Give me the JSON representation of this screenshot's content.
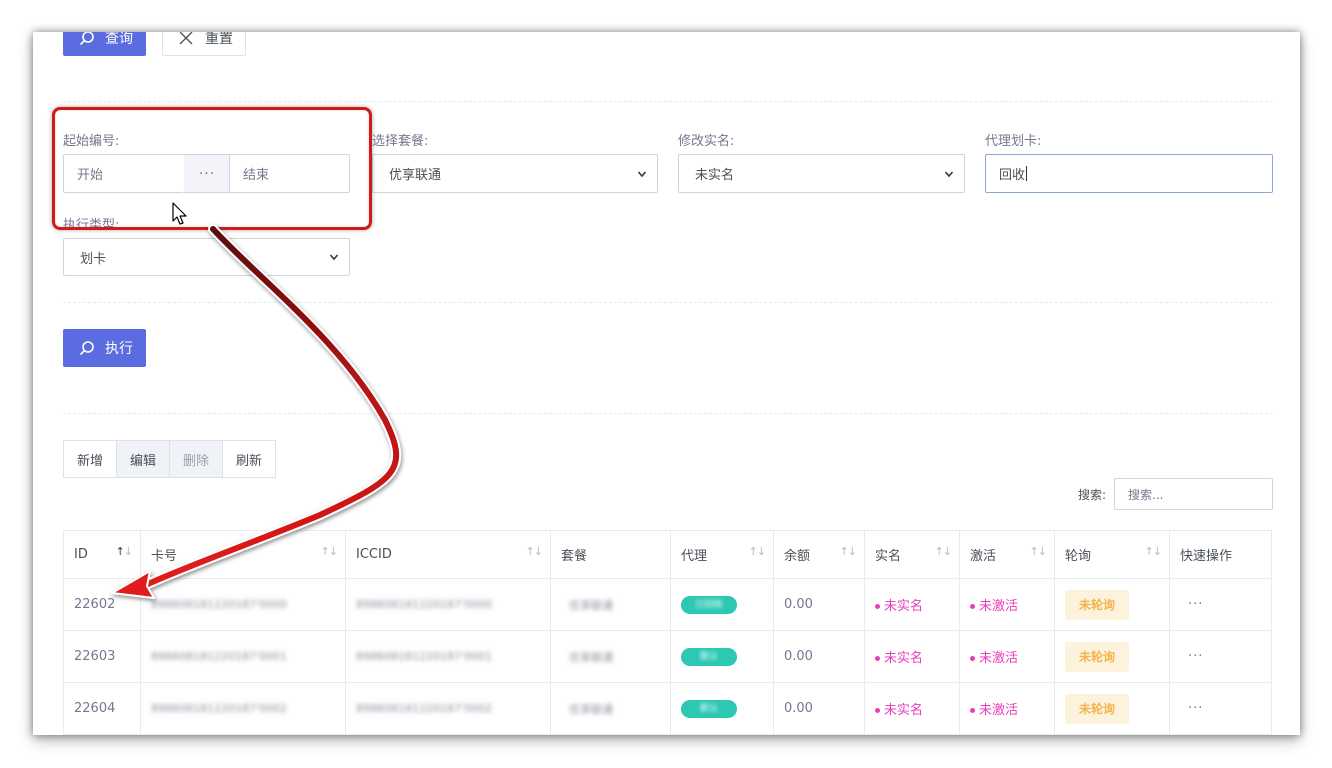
{
  "toolbar": {
    "query_label": "查询",
    "reset_label": "重置"
  },
  "filters": {
    "start_number": {
      "label": "起始编号:",
      "start_placeholder": "开始",
      "separator": "···",
      "end_placeholder": "结束"
    },
    "package": {
      "label": "选择套餐:",
      "value": "优享联通"
    },
    "realname": {
      "label": "修改实名:",
      "value": "未实名"
    },
    "agent": {
      "label": "代理划卡:",
      "value": "回收"
    },
    "exec_type": {
      "label": "执行类型:",
      "value": "划卡"
    }
  },
  "execute_label": "执行",
  "actions": {
    "add": "新增",
    "edit": "编辑",
    "delete": "删除",
    "refresh": "刷新"
  },
  "search": {
    "label": "搜索:",
    "placeholder": "搜索..."
  },
  "table": {
    "columns": [
      "ID",
      "卡号",
      "ICCID",
      "套餐",
      "代理",
      "余额",
      "实名",
      "激活",
      "轮询",
      "快速操作"
    ],
    "rows": [
      {
        "id": "22602",
        "card": "898608181220187'0000",
        "iccid": "898608181220187'0000",
        "package": "优享联通",
        "agent": "已回收",
        "balance": "0.00",
        "realname": "未实名",
        "activated": "未激活",
        "polling": "未轮询",
        "ops": "···"
      },
      {
        "id": "22603",
        "card": "898608181220187'0001",
        "iccid": "898608181220187'0001",
        "package": "优享联通",
        "agent": "默认",
        "balance": "0.00",
        "realname": "未实名",
        "activated": "未激活",
        "polling": "未轮询",
        "ops": "···"
      },
      {
        "id": "22604",
        "card": "898608181220187'0002",
        "iccid": "898608181220187'0002",
        "package": "优享联通",
        "agent": "默认",
        "balance": "0.00",
        "realname": "未实名",
        "activated": "未激活",
        "polling": "未轮询",
        "ops": "···"
      }
    ]
  },
  "colors": {
    "primary": "#5b6be0",
    "status_pink": "#e83ebb",
    "warn_text": "#f1b44c",
    "warn_bg": "#fdf3dd",
    "agent_pill": "#2cc8b3",
    "annotation_red": "#d21a1a"
  },
  "icons": {
    "query": "search-icon",
    "reset": "close-icon",
    "execute": "search-icon",
    "select": "chevron-down-icon",
    "cursor": "mouse-pointer-icon"
  }
}
